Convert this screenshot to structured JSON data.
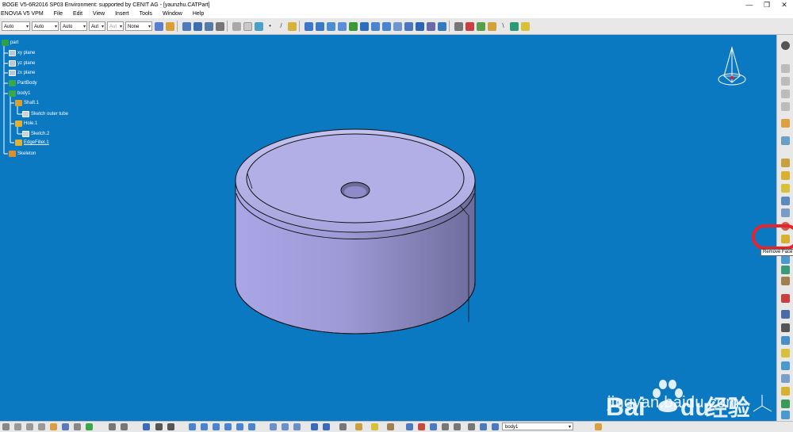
{
  "window": {
    "title": "BOGE V5-6R2016 SP03 Environment: supported by CENIT AG - [yaunzhu.CATPart]",
    "controls": [
      "—",
      "❐",
      "✕"
    ]
  },
  "menu": [
    "ENOVIA V5 VPM",
    "File",
    "Edit",
    "View",
    "Insert",
    "Tools",
    "Window",
    "Help"
  ],
  "toolbar": {
    "combos": [
      {
        "value": "Auto",
        "disabled": false
      },
      {
        "value": "Auto",
        "disabled": false
      },
      {
        "value": "Auto",
        "disabled": false
      },
      {
        "value": "Aut",
        "disabled": false
      },
      {
        "value": "Aut",
        "disabled": true
      },
      {
        "value": "None",
        "disabled": false
      }
    ]
  },
  "tree": {
    "nodes": [
      {
        "label": "part",
        "icon": "part-icon"
      },
      {
        "label": "xy plane",
        "icon": "plane-icon"
      },
      {
        "label": "yz plane",
        "icon": "plane-icon"
      },
      {
        "label": "zx plane",
        "icon": "plane-icon"
      },
      {
        "label": "PartBody",
        "icon": "body-icon"
      },
      {
        "label": "body1",
        "icon": "body-icon"
      },
      {
        "label": "Shaft.1",
        "icon": "shaft-icon"
      },
      {
        "label": "Sketch outer tube",
        "icon": "sketch-icon"
      },
      {
        "label": "Hole.1",
        "icon": "hole-icon"
      },
      {
        "label": "Sketch.2",
        "icon": "sketch-icon"
      },
      {
        "label": "EdgeFillet.1",
        "icon": "fillet-icon"
      },
      {
        "label": "Skeleton",
        "icon": "skeleton-icon"
      }
    ]
  },
  "tooltip": "Remove Face",
  "statusbar": {
    "body_combo": "body1"
  },
  "watermark": {
    "brand": "Bai",
    "brand2": "du",
    "chinese": "经验",
    "url": "jingyan.baidu.com"
  },
  "colors": {
    "viewport": "#0b78c2",
    "part_fill": "#b7b5e8",
    "highlight_circle": "#e8232a"
  }
}
